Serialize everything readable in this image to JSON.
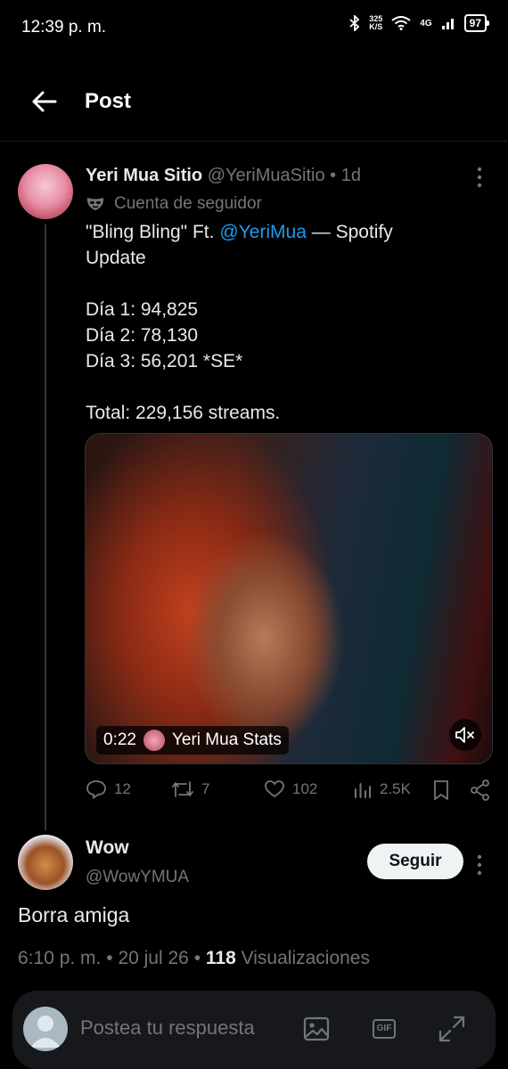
{
  "status_bar": {
    "time": "12:39 p. m.",
    "net_speed_value": "325",
    "net_speed_unit": "K/S",
    "network": "4G",
    "battery": "97"
  },
  "header": {
    "title": "Post",
    "back_icon": "arrow-left-icon"
  },
  "post": {
    "author_name": "Yeri Mua Sitio",
    "handle": "@YeriMuaSitio",
    "separator": "•",
    "time_ago": "1d",
    "follower_label": "Cuenta de seguidor",
    "text_before_mention": "\"Bling Bling\" Ft. ",
    "mention": "@YeriMua",
    "text_after_mention": " — Spotify\nUpdate\n\nDía 1: 94,825\nDía 2: 78,130\nDía 3: 56,201 *SE*\n\nTotal: 229,156 streams.",
    "video": {
      "duration": "0:22",
      "source": "Yeri Mua Stats",
      "mute_icon": "speaker-muted-icon"
    },
    "actions": {
      "replies": "12",
      "reposts": "7",
      "likes": "102",
      "views": "2.5K"
    }
  },
  "reply": {
    "author_name": "Wow",
    "handle": "@WowYMUA",
    "follow_label": "Seguir",
    "text": "Borra amiga",
    "timestamp": "6:10 p. m.",
    "date": "20 jul 26",
    "separator": "•",
    "views_count": "118",
    "views_label": "Visualizaciones"
  },
  "reply_bar": {
    "placeholder": "Postea tu respuesta",
    "gif_label": "GIF"
  },
  "colors": {
    "background": "#000000",
    "text": "#e7e9ea",
    "secondary": "#71767b",
    "accent": "#1d9bf0"
  }
}
